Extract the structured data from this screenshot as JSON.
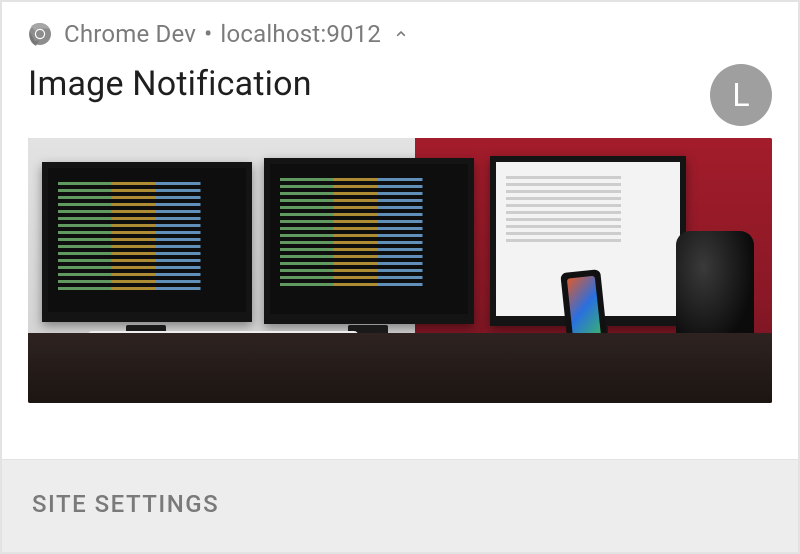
{
  "header": {
    "app_name": "Chrome Dev",
    "origin": "localhost:9012",
    "separator": "•"
  },
  "notification": {
    "title": "Image Notification",
    "badge_letter": "L",
    "image_alt": "Developer desk with multiple monitors"
  },
  "footer": {
    "site_settings_label": "SITE SETTINGS"
  }
}
